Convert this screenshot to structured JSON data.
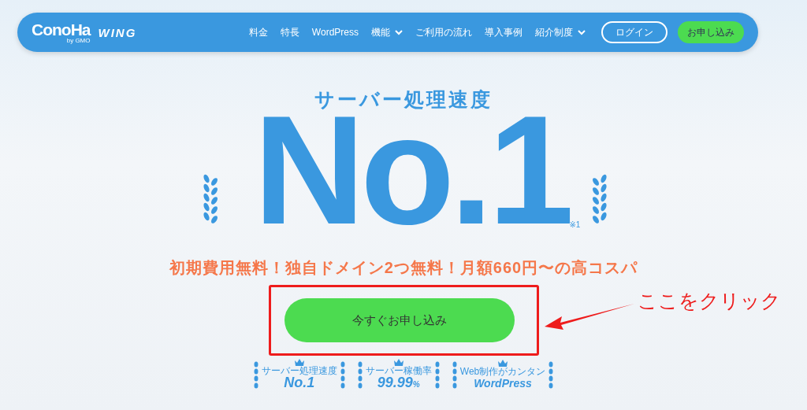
{
  "nav": {
    "logo": {
      "brand": "ConoHa",
      "by": "by GMO",
      "product": "WING"
    },
    "items": [
      {
        "label": "料金",
        "dropdown": false
      },
      {
        "label": "特長",
        "dropdown": false
      },
      {
        "label": "WordPress",
        "dropdown": false
      },
      {
        "label": "機能",
        "dropdown": true
      },
      {
        "label": "ご利用の流れ",
        "dropdown": false
      },
      {
        "label": "導入事例",
        "dropdown": false
      },
      {
        "label": "紹介制度",
        "dropdown": true
      }
    ],
    "login": "ログイン",
    "apply": "お申し込み"
  },
  "hero": {
    "eyebrow": "サーバー処理速度",
    "headline": "No.1",
    "footnote": "※1",
    "tagline": "初期費用無料！独自ドメイン2つ無料！月額660円〜の高コスパ",
    "cta": "今すぐお申し込み",
    "annotation": "ここをクリック",
    "badges": [
      {
        "caption": "サーバー処理速度",
        "value": "No.1"
      },
      {
        "caption": "サーバー稼働率",
        "value": "99.99",
        "unit": "%"
      },
      {
        "caption": "Web制作がカンタン",
        "value": "WordPress"
      }
    ]
  }
}
